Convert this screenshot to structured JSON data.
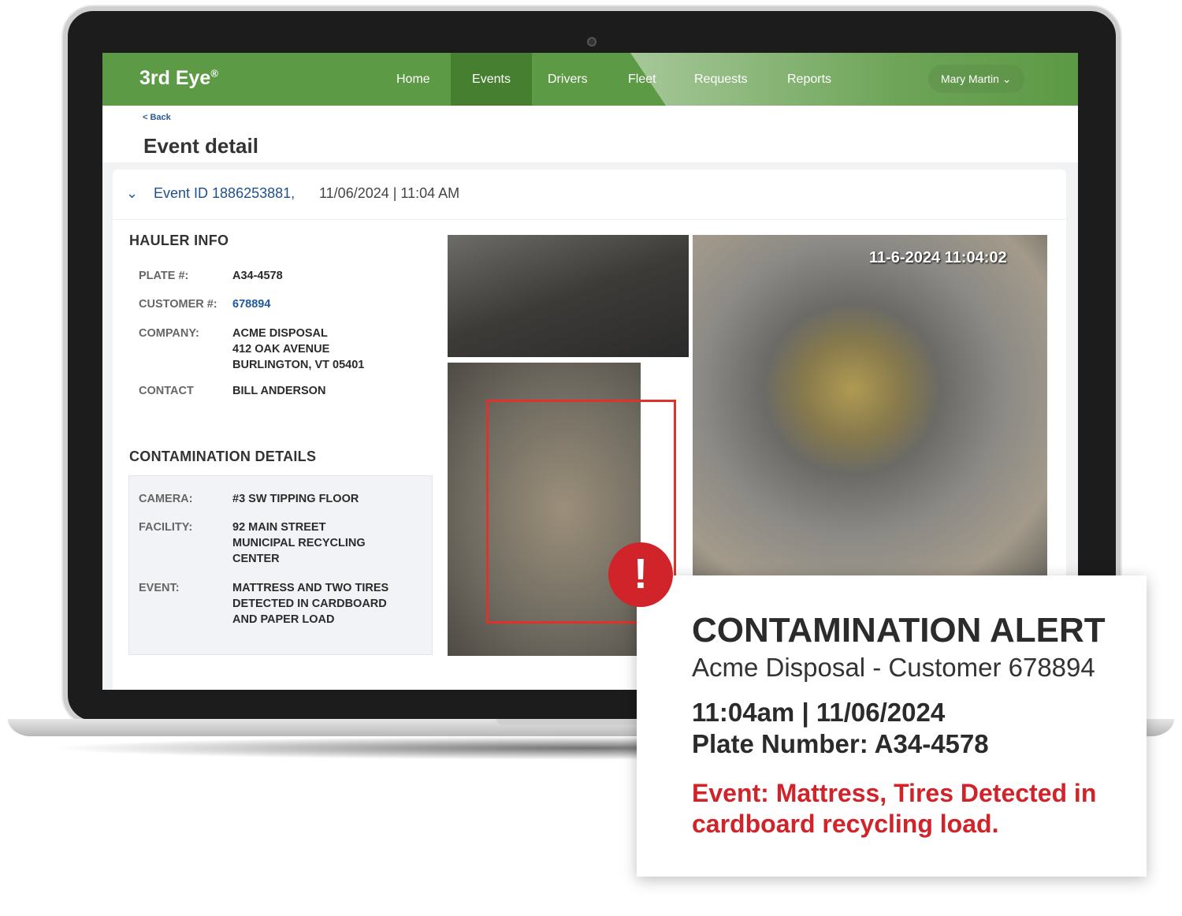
{
  "app": {
    "logo": "3rd Eye",
    "logo_mark": "®"
  },
  "nav": {
    "items": [
      {
        "label": "Home"
      },
      {
        "label": "Events",
        "active": true
      },
      {
        "label": "Drivers"
      },
      {
        "label": "Fleet"
      },
      {
        "label": "Requests"
      },
      {
        "label": "Reports"
      }
    ],
    "user": "Mary Martin"
  },
  "header": {
    "back": "< Back",
    "title": "Event detail"
  },
  "event": {
    "id": "Event ID 1886253881,",
    "datetime": "11/06/2024  | 11:04 AM"
  },
  "hauler": {
    "heading": "HAULER INFO",
    "rows": [
      {
        "label": "PLATE #:",
        "value": "A34-4578"
      },
      {
        "label": "CUSTOMER #:",
        "value": "678894"
      },
      {
        "label": "COMPANY:",
        "value": "ACME DISPOSAL\n412 OAK AVENUE\nBURLINGTON, VT 05401"
      },
      {
        "label": "CONTACT",
        "value": "BILL ANDERSON"
      }
    ]
  },
  "contamination": {
    "heading": "CONTAMINATION DETAILS",
    "rows": [
      {
        "label": "CAMERA:",
        "value": "#3 SW TIPPING FLOOR"
      },
      {
        "label": "FACILITY:",
        "value": "92 MAIN STREET\nMUNICIPAL RECYCLING\nCENTER"
      },
      {
        "label": "EVENT:",
        "value": "MATTRESS AND TWO TIRES\nDETECTED IN CARDBOARD\nAND PAPER LOAD"
      }
    ]
  },
  "camera": {
    "timestamp": "11-6-2024 11:04:02"
  },
  "alert": {
    "icon": "exclamation-icon",
    "title": "CONTAMINATION ALERT",
    "subtitle": "Acme Disposal - Customer 678894",
    "time": "11:04am | 11/06/2024",
    "plate": "Plate Number: A34-4578",
    "event": "Event: Mattress, Tires Detected in cardboard recycling load."
  },
  "colors": {
    "nav": "#5d9a45",
    "nav_active": "#477f31",
    "link": "#1f4f8f",
    "alert_red": "#d1232a"
  }
}
